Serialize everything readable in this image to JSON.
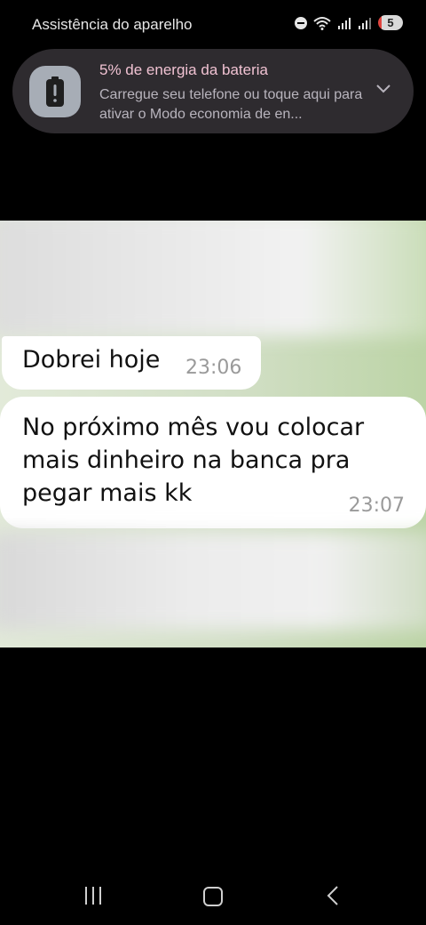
{
  "status_bar": {
    "app_title": "Assistência do aparelho",
    "battery_level": "5",
    "icons": [
      "do-not-disturb-icon",
      "wifi-icon",
      "signal-icon",
      "signal-icon",
      "battery-icon"
    ]
  },
  "notification": {
    "title": "5% de energia da bateria",
    "body": "Carregue seu telefone ou toque aqui para ativar o Modo economia de en...",
    "icon": "battery-alert-icon",
    "expand_icon": "chevron-down-icon"
  },
  "chat": {
    "messages": [
      {
        "text": "Dobrei hoje",
        "time": "23:06"
      },
      {
        "text": "No próximo mês vou colocar mais dinheiro na banca pra pegar mais kk",
        "time": "23:07"
      }
    ]
  },
  "nav_bar": {
    "buttons": [
      "recent-apps-icon",
      "home-icon",
      "back-icon"
    ]
  },
  "colors": {
    "notification_bg": "#2e2b2f",
    "notification_title": "#f0c2d2",
    "chat_wallpaper": "#cfe0bf",
    "bubble": "#ffffff",
    "timestamp": "#9a9a9a"
  }
}
